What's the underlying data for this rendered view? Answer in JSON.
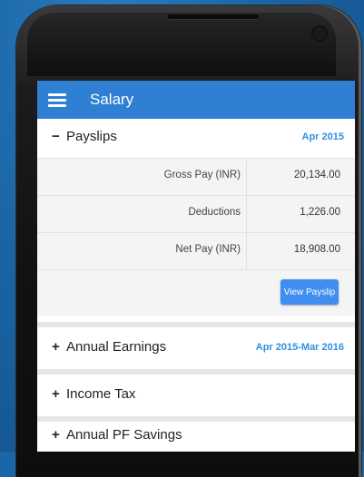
{
  "appbar": {
    "title": "Salary"
  },
  "payslips": {
    "sign": "−",
    "title": "Payslips",
    "period": "Apr 2015",
    "rows": [
      {
        "label": "Gross Pay (INR)",
        "value": "20,134.00"
      },
      {
        "label": "Deductions",
        "value": "1,226.00"
      },
      {
        "label": "Net Pay (INR)",
        "value": "18,908.00"
      }
    ],
    "button_label": "View Payslip"
  },
  "annual_earnings": {
    "sign": "+",
    "title": "Annual Earnings",
    "period": "Apr 2015-Mar 2016"
  },
  "income_tax": {
    "sign": "+",
    "title": "Income Tax"
  },
  "pf_savings": {
    "sign": "+",
    "title": "Annual PF Savings"
  },
  "colors": {
    "background": "#1b66a6",
    "appbar": "#2f7fd3",
    "accent": "#2f8ee0",
    "button": "#3f8ef0"
  },
  "icons": {
    "menu": "hamburger-icon"
  }
}
